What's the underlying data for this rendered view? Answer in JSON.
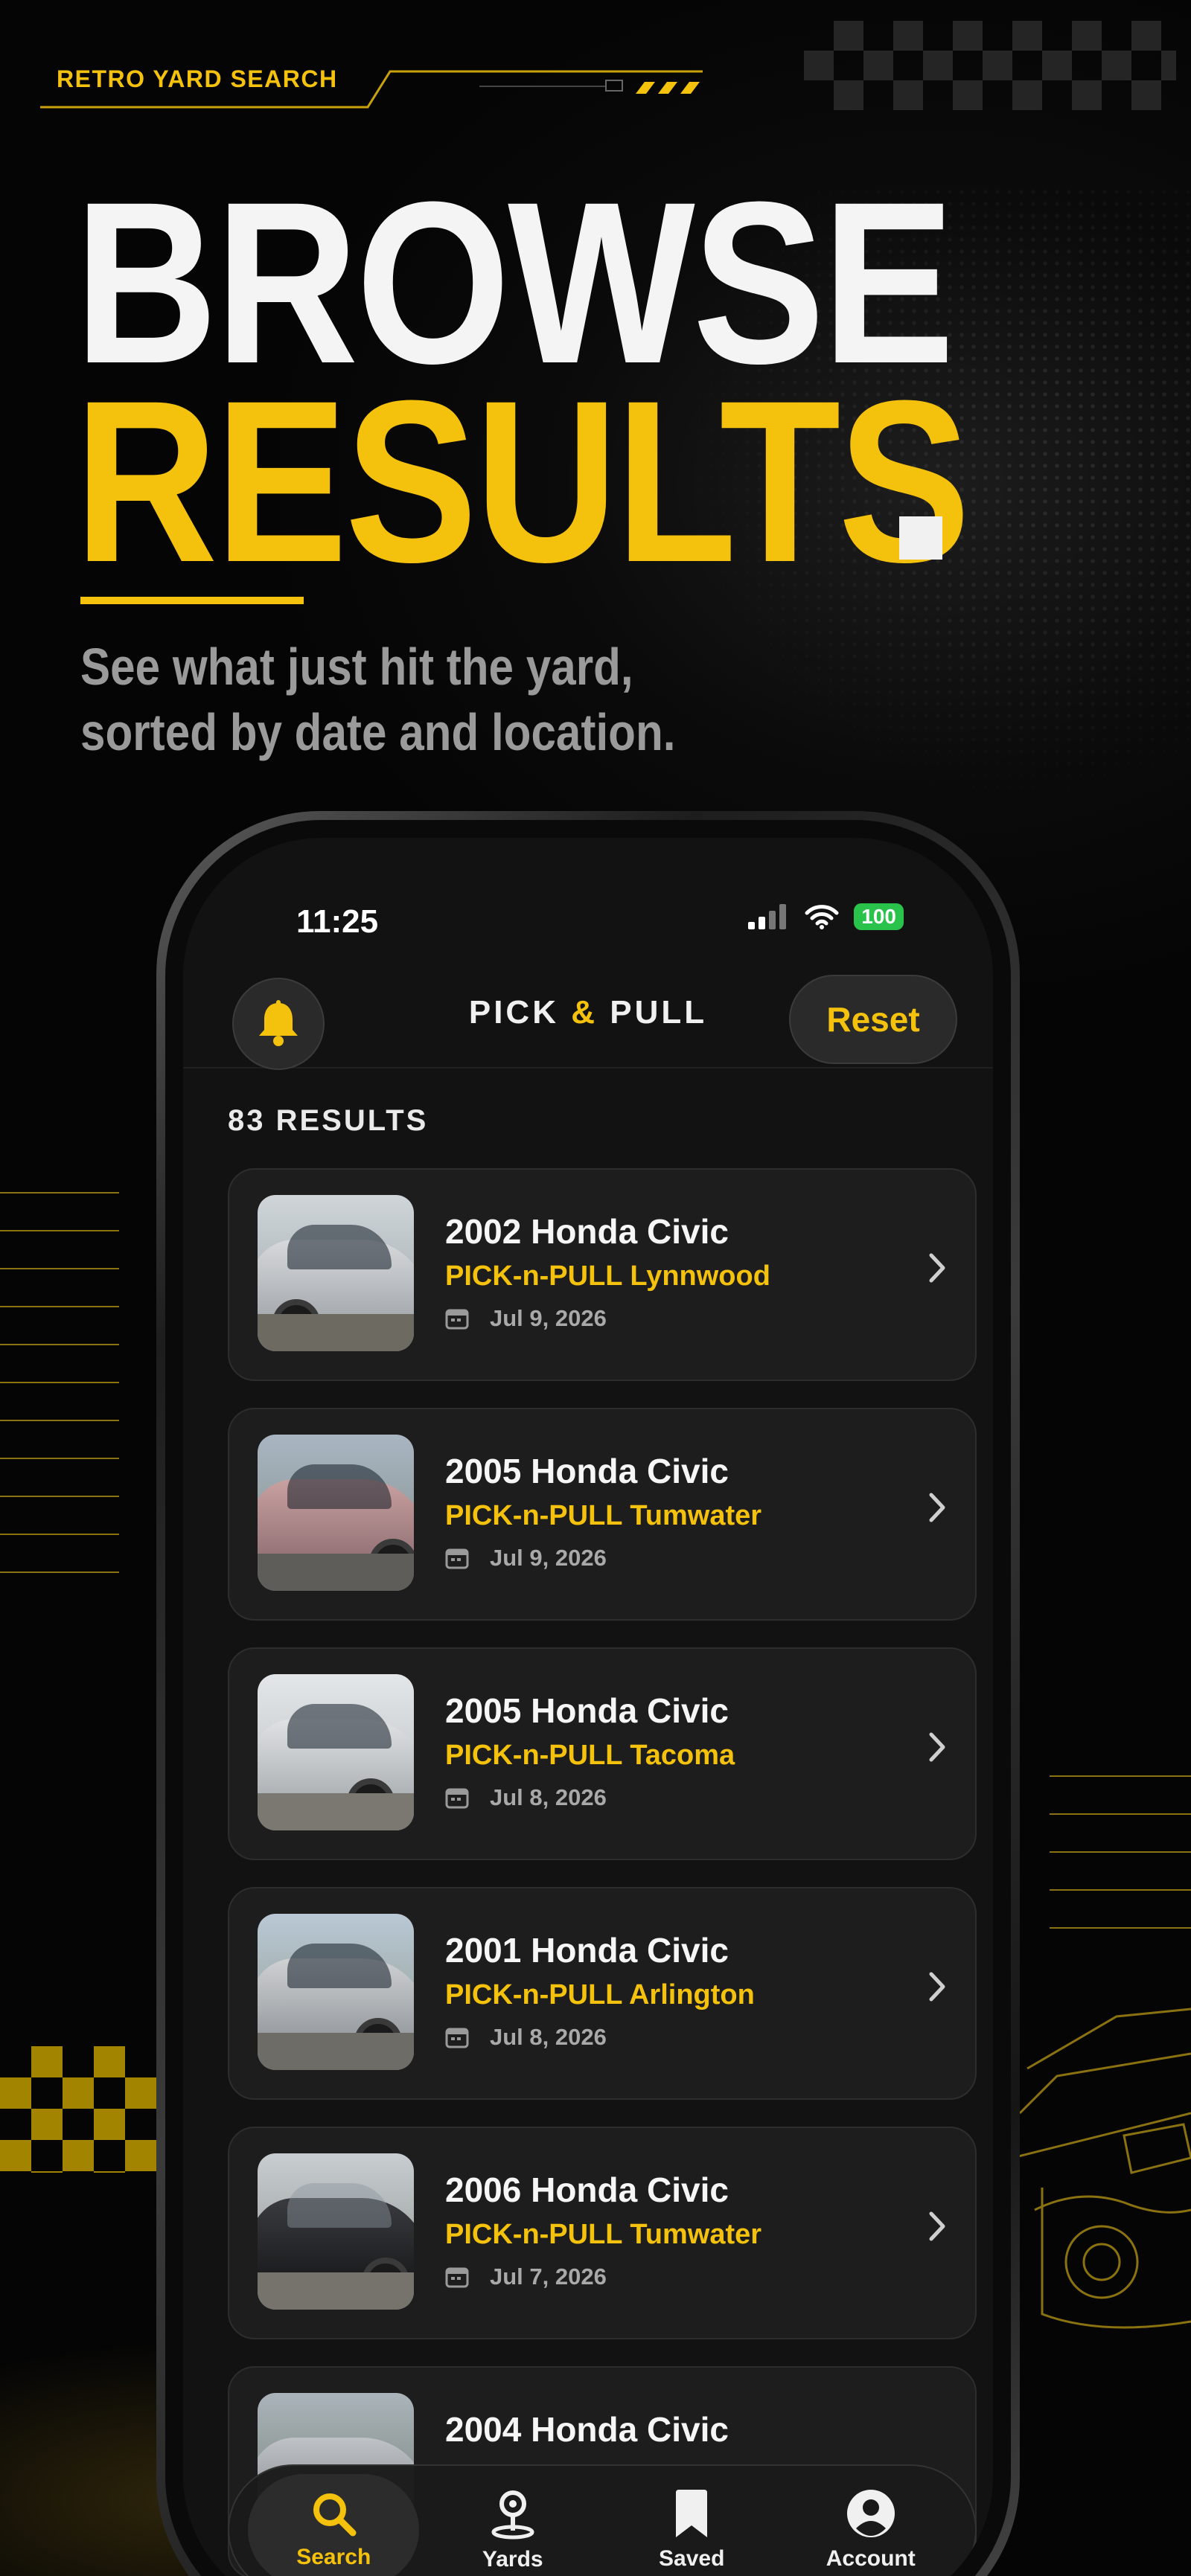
{
  "promo": {
    "brand_tag": "RETRO YARD SEARCH",
    "headline_line1": "BROWSE",
    "headline_line2": "RESULTS",
    "subtitle_line1": "See what just hit the yard,",
    "subtitle_line2": "sorted by date and location."
  },
  "colors": {
    "accent": "#F4C20D",
    "background": "#050505",
    "card": "#1D1D1D",
    "battery": "#29C24A"
  },
  "status_bar": {
    "time": "11:25",
    "battery": "100"
  },
  "app_bar": {
    "title_left": "PICK",
    "title_amp": "&",
    "title_right": "PULL",
    "reset_label": "Reset"
  },
  "results": {
    "count_label": "83 RESULTS",
    "items": [
      {
        "title": "2002 Honda Civic",
        "yard": "PICK-n-PULL Lynnwood",
        "date": "Jul 9, 2026",
        "photo": "silver-sedan"
      },
      {
        "title": "2005 Honda Civic",
        "yard": "PICK-n-PULL Tumwater",
        "date": "Jul 9, 2026",
        "photo": "rose-sedan"
      },
      {
        "title": "2005 Honda Civic",
        "yard": "PICK-n-PULL Tacoma",
        "date": "Jul 8, 2026",
        "photo": "silver-sedan-damaged"
      },
      {
        "title": "2001 Honda Civic",
        "yard": "PICK-n-PULL Arlington",
        "date": "Jul 8, 2026",
        "photo": "silver-sedan-lot"
      },
      {
        "title": "2006 Honda Civic",
        "yard": "PICK-n-PULL Tumwater",
        "date": "Jul 7, 2026",
        "photo": "black-sedan"
      },
      {
        "title": "2004 Honda Civic",
        "yard": "",
        "date": "",
        "photo": "partial"
      }
    ]
  },
  "tab_bar": {
    "tabs": [
      {
        "label": "Search",
        "icon": "search-icon",
        "active": true
      },
      {
        "label": "Yards",
        "icon": "map-pin-icon",
        "active": false
      },
      {
        "label": "Saved",
        "icon": "bookmark-icon",
        "active": false
      },
      {
        "label": "Account",
        "icon": "account-icon",
        "active": false
      }
    ]
  }
}
